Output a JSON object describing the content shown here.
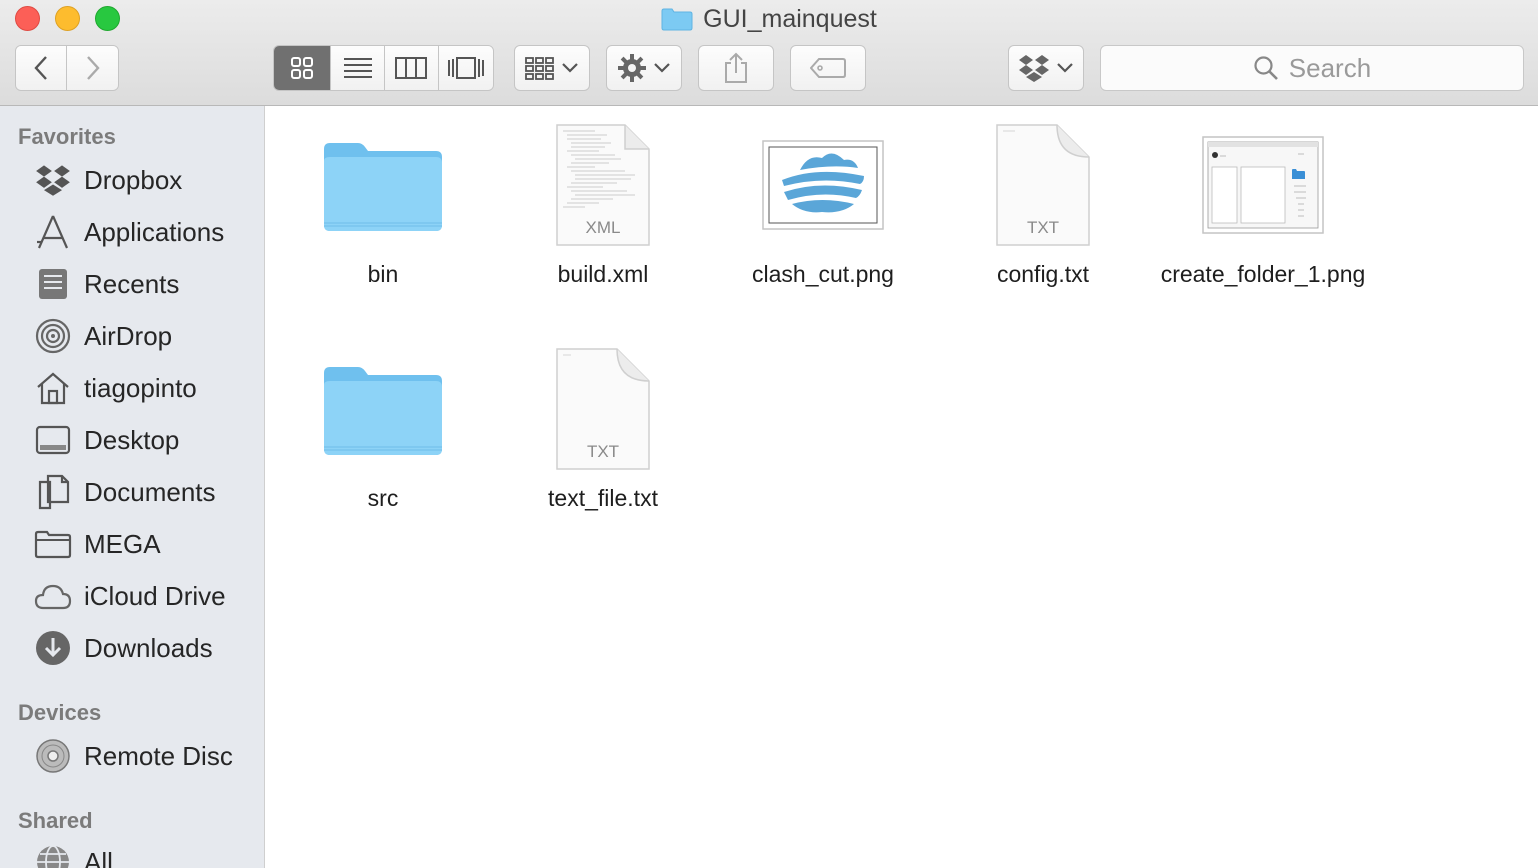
{
  "window": {
    "title": "GUI_mainquest"
  },
  "toolbar": {
    "search_placeholder": "Search",
    "view_modes": [
      "icon",
      "list",
      "column",
      "cover-flow"
    ],
    "active_view": "icon"
  },
  "sidebar": {
    "sections": [
      {
        "heading": "Favorites",
        "items": [
          {
            "label": "Dropbox",
            "icon": "dropbox-icon"
          },
          {
            "label": "Applications",
            "icon": "applications-icon"
          },
          {
            "label": "Recents",
            "icon": "recents-icon"
          },
          {
            "label": "AirDrop",
            "icon": "airdrop-icon"
          },
          {
            "label": "tiagopinto",
            "icon": "home-icon"
          },
          {
            "label": "Desktop",
            "icon": "desktop-icon"
          },
          {
            "label": "Documents",
            "icon": "documents-icon"
          },
          {
            "label": "MEGA",
            "icon": "folder-icon"
          },
          {
            "label": "iCloud Drive",
            "icon": "cloud-icon"
          },
          {
            "label": "Downloads",
            "icon": "downloads-icon"
          }
        ]
      },
      {
        "heading": "Devices",
        "items": [
          {
            "label": "Remote Disc",
            "icon": "disc-icon"
          }
        ]
      },
      {
        "heading": "Shared",
        "items": [
          {
            "label": "All...",
            "icon": "network-icon"
          }
        ]
      }
    ]
  },
  "files": [
    {
      "name": "bin",
      "kind": "folder"
    },
    {
      "name": "build.xml",
      "kind": "document",
      "ext": "XML"
    },
    {
      "name": "clash_cut.png",
      "kind": "image"
    },
    {
      "name": "config.txt",
      "kind": "document",
      "ext": "TXT"
    },
    {
      "name": "create_folder_1.png",
      "kind": "screenshot"
    },
    {
      "name": "src",
      "kind": "folder"
    },
    {
      "name": "text_file.txt",
      "kind": "document",
      "ext": "TXT"
    }
  ],
  "colors": {
    "folder": "#7ccaf3",
    "sidebar_bg": "#e6e9ee",
    "active_segment": "#707070"
  }
}
